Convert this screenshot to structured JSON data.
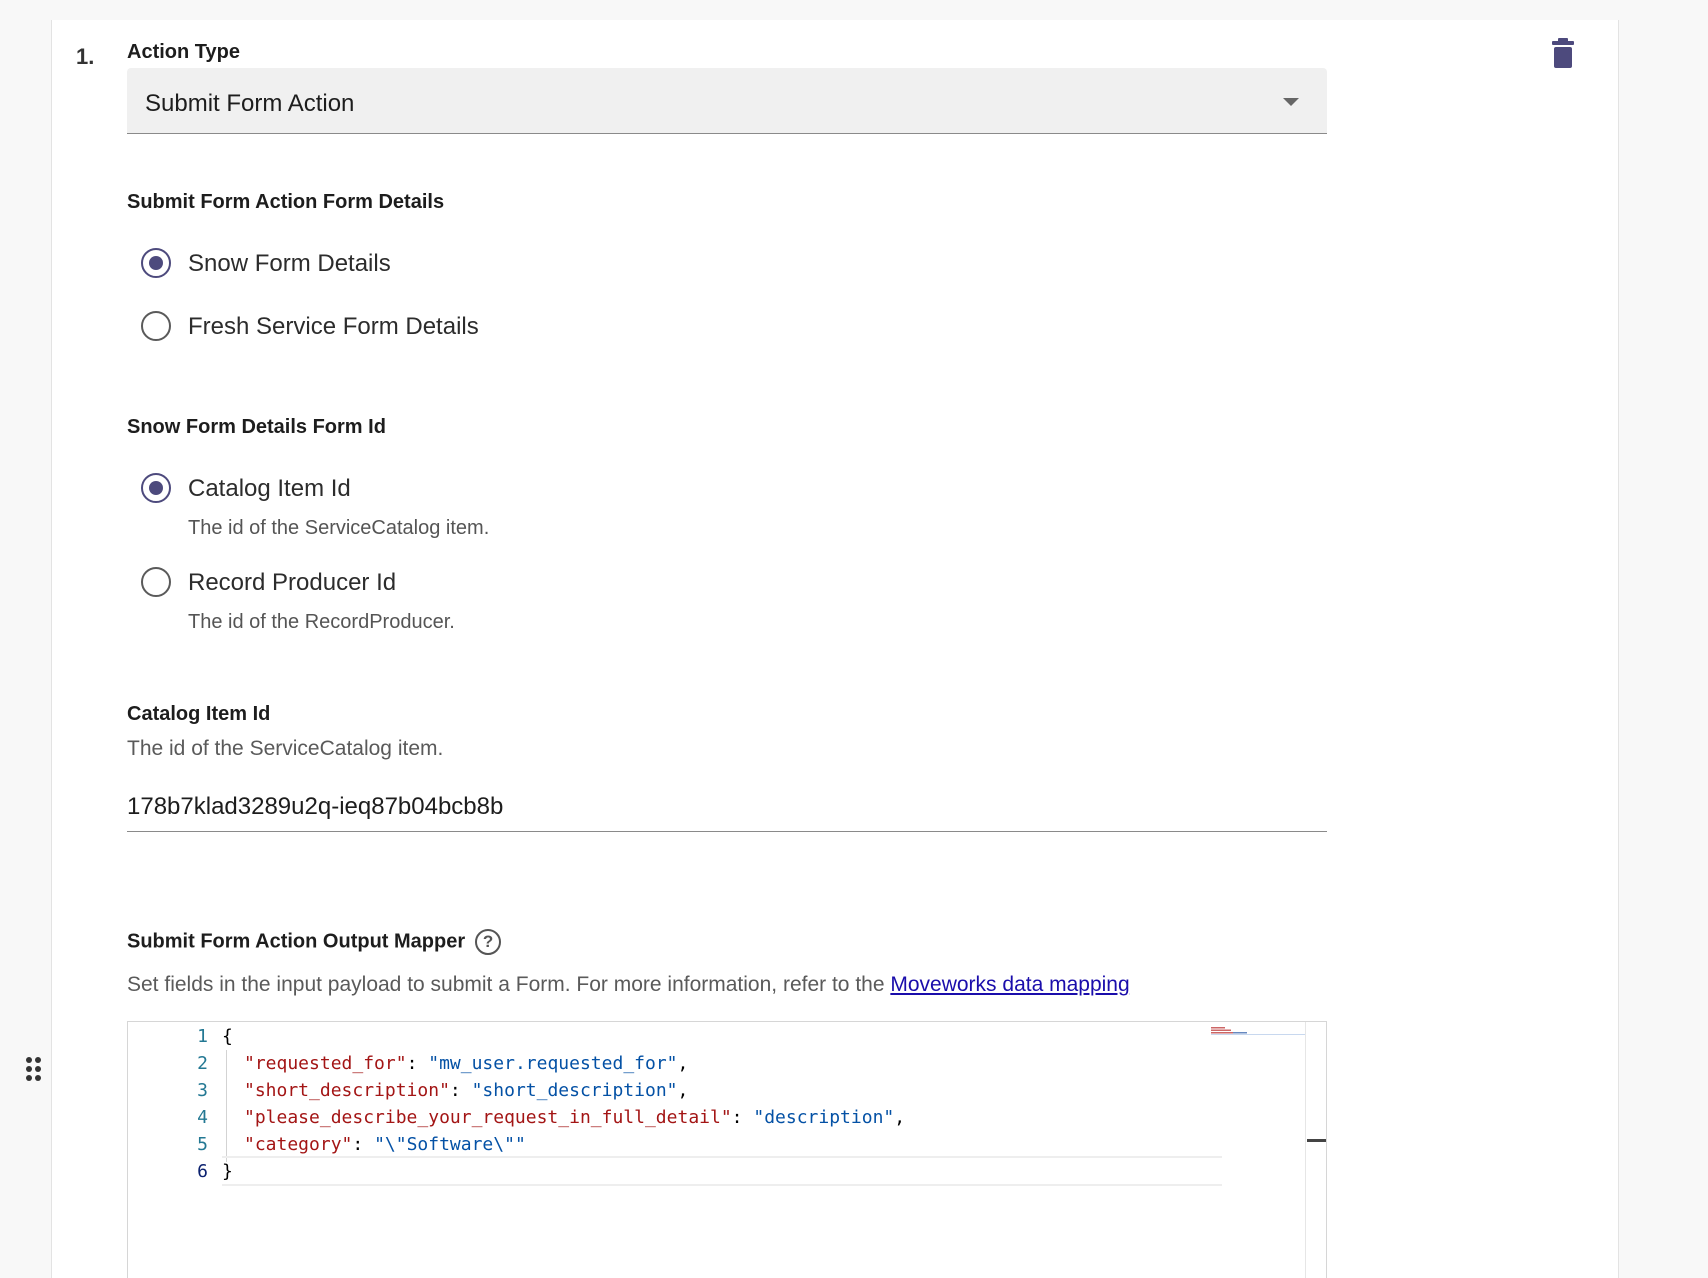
{
  "step": {
    "number": "1."
  },
  "action_type": {
    "label": "Action Type",
    "selected": "Submit Form Action"
  },
  "form_details": {
    "label": "Submit Form Action Form Details",
    "options": [
      {
        "label": "Snow Form Details",
        "checked": true
      },
      {
        "label": "Fresh Service Form Details",
        "checked": false
      }
    ]
  },
  "form_id": {
    "label": "Snow Form Details Form Id",
    "options": [
      {
        "label": "Catalog Item Id",
        "help": "The id of the ServiceCatalog item.",
        "checked": true
      },
      {
        "label": "Record Producer Id",
        "help": "The id of the RecordProducer.",
        "checked": false
      }
    ]
  },
  "catalog_item": {
    "label": "Catalog Item Id",
    "help": "The id of the ServiceCatalog item.",
    "value": "178b7klad3289u2q-ieq87b04bcb8b"
  },
  "output_mapper": {
    "label": "Submit Form Action Output Mapper",
    "help_prefix": "Set fields in the input payload to submit a Form. For more information, refer to the ",
    "help_link": "Moveworks data mapping",
    "code": {
      "line_numbers": [
        "1",
        "2",
        "3",
        "4",
        "5",
        "6"
      ],
      "lines": [
        {
          "key": "",
          "sep": "",
          "value": "",
          "raw": "{"
        },
        {
          "key": "\"requested_for\"",
          "sep": ": ",
          "value": "\"mw_user.requested_for\"",
          "tail": ","
        },
        {
          "key": "\"short_description\"",
          "sep": ": ",
          "value": "\"short_description\"",
          "tail": ","
        },
        {
          "key": "\"please_describe_your_request_in_full_detail\"",
          "sep": ": ",
          "value": "\"description\"",
          "tail": ","
        },
        {
          "key": "\"category\"",
          "sep": ": ",
          "value": "\"\\\"Software\\\"\"",
          "tail": ""
        },
        {
          "key": "",
          "sep": "",
          "value": "",
          "raw": "}"
        }
      ]
    }
  },
  "colors": {
    "accent": "#4d4a7d",
    "link": "#1a0dab",
    "json_key": "#a31515",
    "json_string": "#0451a5"
  },
  "icons": {
    "delete": "trash-icon",
    "help": "help-circle-icon",
    "drag": "drag-handle-icon",
    "dropdown": "caret-down-icon"
  }
}
